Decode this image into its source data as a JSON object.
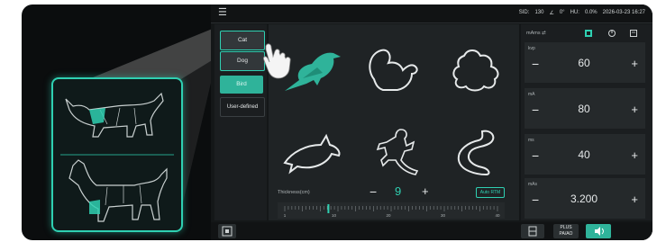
{
  "topbar": {
    "sid_label": "SID:",
    "sid_value": "130",
    "angle_value": "0°",
    "hu_label": "HU:",
    "hu_value": "0.0%",
    "datetime": "2026-03-23 16:27"
  },
  "species": {
    "cat": "Cat",
    "dog": "Dog",
    "bird": "Bird",
    "user_defined": "User-defined"
  },
  "animals": [
    "bird",
    "squirrel",
    "turtle",
    "dolphin",
    "lizard",
    "snake"
  ],
  "thickness": {
    "label": "Thickness(cm)",
    "value": "9",
    "auto_label": "Auto RTM",
    "ticks": [
      "1",
      "10",
      "20",
      "30",
      "40"
    ],
    "current": 9,
    "min": 1,
    "max": 40
  },
  "params": {
    "mode": "mAms ⇄",
    "kvp_label": "kvp",
    "kvp_value": "60",
    "mas_label": "mA",
    "mas_value": "80",
    "ms_label": "ms",
    "ms_value": "40",
    "mas2_label": "mAs",
    "mas2_value": "3.200"
  },
  "bottombar": {
    "plus_label": "PLUS",
    "plus2_label": "PA/AO"
  },
  "colors": {
    "accent": "#2fd0b2",
    "background": "#141718"
  }
}
